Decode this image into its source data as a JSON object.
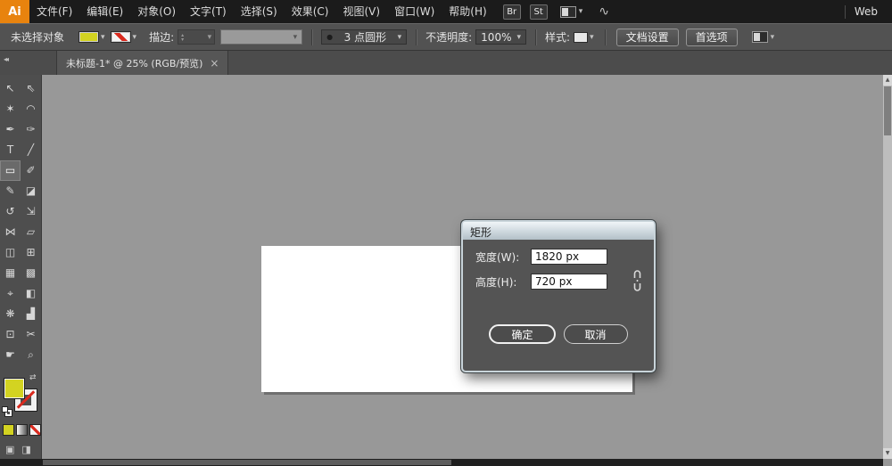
{
  "titlebar": {
    "logo": "Ai",
    "menus": [
      "文件(F)",
      "编辑(E)",
      "对象(O)",
      "文字(T)",
      "选择(S)",
      "效果(C)",
      "视图(V)",
      "窗口(W)",
      "帮助(H)"
    ],
    "bridge": "Br",
    "stock": "St",
    "workspace": "Web"
  },
  "control_bar": {
    "status": "未选择对象",
    "stroke_label": "描边:",
    "brush_name": "3 点圆形",
    "opacity_label": "不透明度:",
    "opacity_value": "100%",
    "style_label": "样式:",
    "document_setup": "文档设置",
    "preferences": "首选项"
  },
  "tab": {
    "title": "未标题-1* @ 25% (RGB/预览)"
  },
  "dialog": {
    "title": "矩形",
    "width_label": "宽度(W):",
    "width_value": "1820 px",
    "height_label": "高度(H):",
    "height_value": "720 px",
    "ok": "确定",
    "cancel": "取消"
  },
  "tools": [
    {
      "name": "selection-tool",
      "glyph": "↖"
    },
    {
      "name": "direct-selection-tool",
      "glyph": "⇖"
    },
    {
      "name": "magic-wand-tool",
      "glyph": "✶"
    },
    {
      "name": "lasso-tool",
      "glyph": "◠"
    },
    {
      "name": "pen-tool",
      "glyph": "✒"
    },
    {
      "name": "curvature-tool",
      "glyph": "✑"
    },
    {
      "name": "type-tool",
      "glyph": "T"
    },
    {
      "name": "line-segment-tool",
      "glyph": "╱"
    },
    {
      "name": "rectangle-tool",
      "glyph": "▭",
      "active": true
    },
    {
      "name": "paintbrush-tool",
      "glyph": "✐"
    },
    {
      "name": "pencil-tool",
      "glyph": "✎"
    },
    {
      "name": "eraser-tool",
      "glyph": "◪"
    },
    {
      "name": "rotate-tool",
      "glyph": "↺"
    },
    {
      "name": "scale-tool",
      "glyph": "⇲"
    },
    {
      "name": "width-tool",
      "glyph": "⋈"
    },
    {
      "name": "free-transform-tool",
      "glyph": "▱"
    },
    {
      "name": "shape-builder-tool",
      "glyph": "◫"
    },
    {
      "name": "perspective-grid-tool",
      "glyph": "⊞"
    },
    {
      "name": "mesh-tool",
      "glyph": "▦"
    },
    {
      "name": "gradient-tool",
      "glyph": "▩"
    },
    {
      "name": "eyedropper-tool",
      "glyph": "⌖"
    },
    {
      "name": "blend-tool",
      "glyph": "◧"
    },
    {
      "name": "symbol-sprayer-tool",
      "glyph": "❋"
    },
    {
      "name": "column-graph-tool",
      "glyph": "▟"
    },
    {
      "name": "artboard-tool",
      "glyph": "⊡"
    },
    {
      "name": "slice-tool",
      "glyph": "✂"
    },
    {
      "name": "hand-tool",
      "glyph": "☛"
    },
    {
      "name": "zoom-tool",
      "glyph": "⌕"
    }
  ],
  "icons": {
    "chevron_down": "▾",
    "close": "×",
    "collapse_left": "◂◂",
    "swap": "⇄",
    "tri_up": "▴",
    "tri_down": "▾",
    "scroll_up": "▲",
    "scroll_down": "▼",
    "brush_dot": "●",
    "gesture": "∿",
    "drawing_mode": "▣",
    "screen_mode": "◨"
  },
  "colors": {
    "fill_yellow": "#d3d321",
    "logo_orange": "#e8830e",
    "none_red": "#da2a1e"
  }
}
